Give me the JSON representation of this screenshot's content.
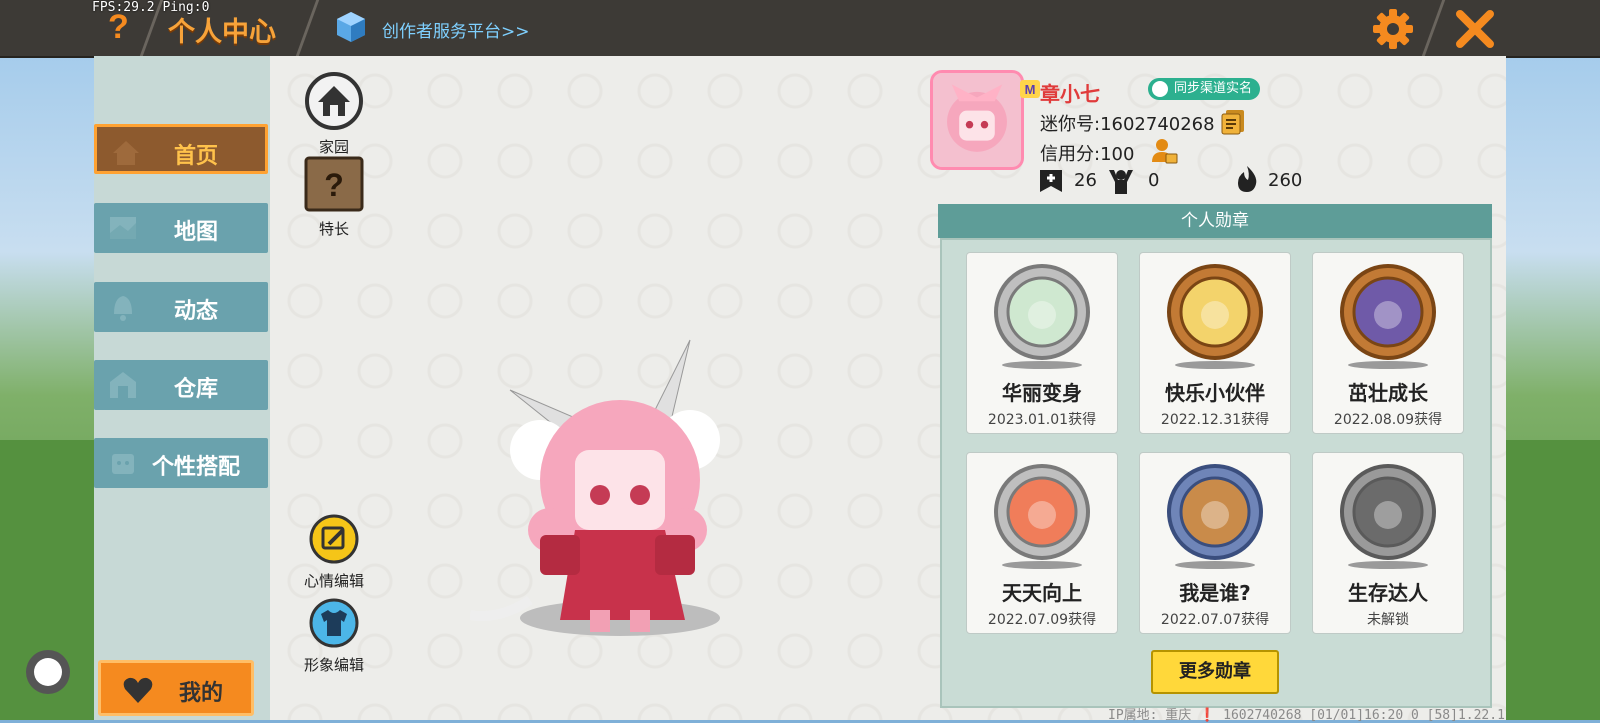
{
  "fps": "FPS:29.2  Ping:0",
  "header": {
    "help_icon": "question-mark",
    "title": "个人中心",
    "creator_link": "创作者服务平台>>",
    "settings_icon": "gear",
    "close_icon": "close-x"
  },
  "sidebar": {
    "items": [
      {
        "label": "首页",
        "icon": "home",
        "active": true
      },
      {
        "label": "地图",
        "icon": "map"
      },
      {
        "label": "动态",
        "icon": "bell"
      },
      {
        "label": "仓库",
        "icon": "warehouse"
      },
      {
        "label": "个性搭配",
        "icon": "outfit"
      }
    ],
    "mine_label": "我的"
  },
  "quick": {
    "home_label": "家园",
    "skill_label": "特长",
    "mood_label": "心情编辑",
    "image_label": "形象编辑"
  },
  "profile": {
    "username": "章小七",
    "realname_badge": "同步渠道实名",
    "mini_id": "迷你号:1602740268",
    "credit": "信用分:100",
    "friends": "26",
    "fans": "0",
    "popularity": "260"
  },
  "medals": {
    "header": "个人勋章",
    "items": [
      {
        "name": "华丽变身",
        "date": "2023.01.01获得",
        "ring": "silver",
        "fill": "#cfe8d0"
      },
      {
        "name": "快乐小伙伴",
        "date": "2022.12.31获得",
        "ring": "bronze",
        "fill": "#f3d36b"
      },
      {
        "name": "茁壮成长",
        "date": "2022.08.09获得",
        "ring": "bronze",
        "fill": "#6f5aa8"
      },
      {
        "name": "天天向上",
        "date": "2022.07.09获得",
        "ring": "silver",
        "fill": "#f07d5a"
      },
      {
        "name": "我是谁?",
        "date": "2022.07.07获得",
        "ring": "blue",
        "fill": "#c98b4a"
      },
      {
        "name": "生存达人",
        "date": "未解锁",
        "ring": "gray",
        "fill": "#6b6b6b"
      }
    ],
    "more_label": "更多勋章"
  },
  "footer": "IP属地: 重庆 ❗   1602740268  [01/01]16:20 0  [58]1.22.1"
}
